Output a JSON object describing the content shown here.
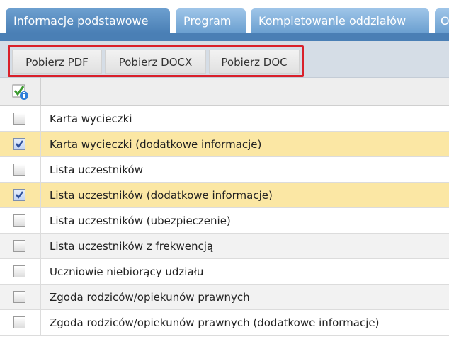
{
  "tabs": [
    {
      "label": "Informacje podstawowe",
      "active": true
    },
    {
      "label": "Program",
      "active": false
    },
    {
      "label": "Kompletowanie oddziałów",
      "active": false
    },
    {
      "label": "O",
      "active": false
    }
  ],
  "toolbar": {
    "buttons": [
      "Pobierz PDF",
      "Pobierz DOCX",
      "Pobierz DOC"
    ]
  },
  "grid": {
    "header_icon": "check-info-icon",
    "rows": [
      {
        "label": "Karta wycieczki",
        "checked": false
      },
      {
        "label": "Karta wycieczki (dodatkowe informacje)",
        "checked": true
      },
      {
        "label": "Lista uczestników",
        "checked": false
      },
      {
        "label": "Lista uczestników (dodatkowe informacje)",
        "checked": true
      },
      {
        "label": "Lista uczestników (ubezpieczenie)",
        "checked": false
      },
      {
        "label": "Lista uczestników z frekwencją",
        "checked": false
      },
      {
        "label": "Uczniowie niebiorący udziału",
        "checked": false
      },
      {
        "label": "Zgoda rodziców/opiekunów prawnych",
        "checked": false
      },
      {
        "label": "Zgoda rodziców/opiekunów prawnych (dodatkowe informacje)",
        "checked": false
      }
    ]
  },
  "colors": {
    "tab_active": "#4a7fb5",
    "selected_row": "#fbe7a4",
    "highlight_border": "#d9202a"
  }
}
